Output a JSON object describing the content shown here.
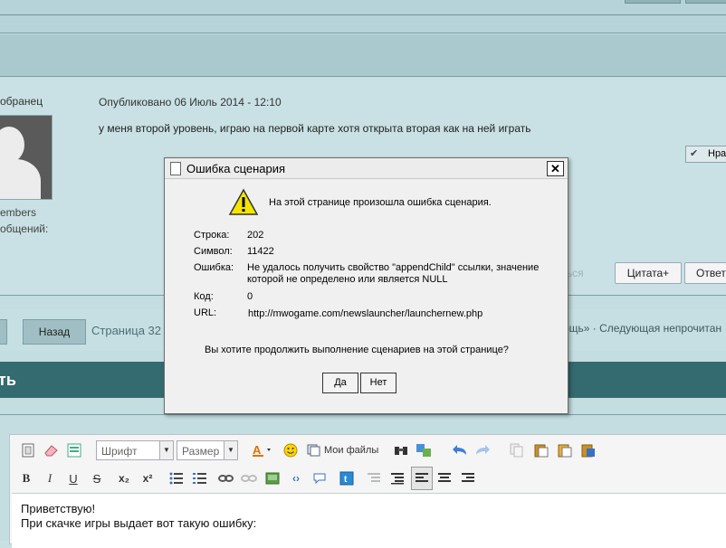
{
  "post": {
    "author_name": "обранец",
    "author_group": "embers",
    "author_posts_label": "общений:",
    "date": "Опубликовано 06 Июль 2014 - 12:10",
    "text": "у меня второй уровень, играю на первой карте хотя открыта вторая как на ней играть",
    "like_label": "Нра",
    "report_label": "аться",
    "quote_button": "Цитата+",
    "reply_button": "Ответ"
  },
  "navigation": {
    "back_button": "Назад",
    "page_info": "Страница 32 и",
    "next_unread": "ощь» · Следующая непрочитан"
  },
  "reply_section": {
    "title": "ть"
  },
  "editor": {
    "font_select": "Шрифт",
    "size_select": "Размер",
    "my_files_label": "Мои файлы",
    "body_lines": [
      "Приветствую!",
      "При скачке игры выдает вот такую ошибку:"
    ],
    "toolbar_row2": {
      "bold": "B",
      "italic": "I",
      "underline": "U",
      "strike": "S",
      "subscript": "x₂",
      "superscript": "x²"
    }
  },
  "dialog": {
    "title": "Ошибка сценария",
    "close_glyph": "✕",
    "message": "На этой странице произошла ошибка сценария.",
    "fields": {
      "line_label": "Строка:",
      "line_value": "202",
      "char_label": "Символ:",
      "char_value": "11422",
      "error_label": "Ошибка:",
      "error_value": "Не удалось получить свойство \"appendChild\" ссылки, значение которой не определено или является NULL",
      "code_label": "Код:",
      "code_value": "0",
      "url_label": "URL:",
      "url_value": "http://mwogame.com/newslauncher/launchernew.php"
    },
    "question": "Вы хотите продолжить выполнение сценариев на этой странице?",
    "yes_button": "Да",
    "no_button": "Нет"
  },
  "colors": {
    "page_bg": "#c4dde0",
    "header_bar": "#a9c9ce",
    "reply_header": "#336b70",
    "warning_yellow": "#f5e400"
  }
}
